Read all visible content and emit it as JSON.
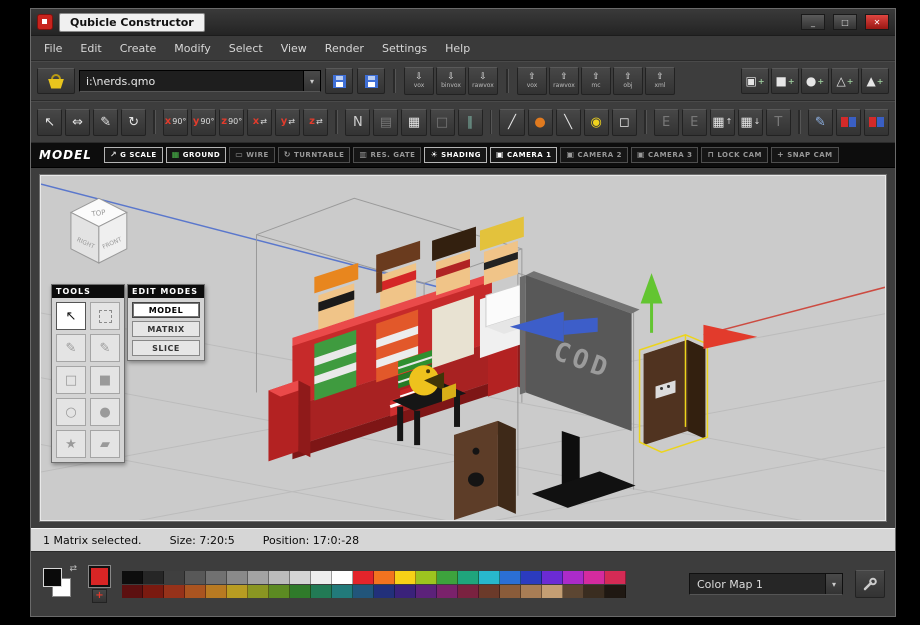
{
  "window": {
    "title": "Qubicle Constructor",
    "controls": {
      "minimize": "_",
      "maximize": "□",
      "close": "✕"
    }
  },
  "menu": {
    "items": [
      "File",
      "Edit",
      "Create",
      "Modify",
      "Select",
      "View",
      "Render",
      "Settings",
      "Help"
    ]
  },
  "file_bar": {
    "path_value": "i:\\nerds.qmo",
    "import_group": [
      "vox",
      "binvox",
      "rawvox"
    ],
    "export_group": [
      "vox",
      "rawvox",
      "mc",
      "obj",
      "xml"
    ],
    "create_shapes": [
      {
        "name": "add-matrix-button",
        "glyph": "▣",
        "color": "#e6e6e6"
      },
      {
        "name": "add-box-button",
        "glyph": "■",
        "color": "#e6e6e6"
      },
      {
        "name": "add-sphere-button",
        "glyph": "●",
        "color": "#e6e6e6"
      },
      {
        "name": "add-triangle-button",
        "glyph": "△",
        "color": "#e6e6e6"
      },
      {
        "name": "add-cone-button",
        "glyph": "▲",
        "color": "#e6e6e6"
      }
    ]
  },
  "tool_row": [
    {
      "name": "transform-tool",
      "glyph": "↖",
      "color": "#e6e6e6"
    },
    {
      "name": "resize-tool",
      "glyph": "⇔",
      "color": "#e6e6e6"
    },
    {
      "name": "draw-tool",
      "glyph": "✎",
      "color": "#e6e6e6"
    },
    {
      "name": "rotate-tool",
      "glyph": "↻",
      "color": "#e6e6e6"
    },
    {
      "type": "sep"
    },
    {
      "name": "rotate-x-90-button",
      "axis": "x",
      "label": "90°"
    },
    {
      "name": "rotate-y-90-button",
      "axis": "y",
      "label": "90°"
    },
    {
      "name": "rotate-z-90-button",
      "axis": "z",
      "label": "90°"
    },
    {
      "name": "mirror-x-button",
      "axis": "x",
      "label": "⇄"
    },
    {
      "name": "mirror-y-button",
      "axis": "y",
      "label": "⇄"
    },
    {
      "name": "mirror-z-button",
      "axis": "z",
      "label": "⇄"
    },
    {
      "type": "sep"
    },
    {
      "name": "normals-tool",
      "glyph": "N",
      "color": "#cfcfcf"
    },
    {
      "name": "copy-button",
      "glyph": "▤",
      "color": "#787878"
    },
    {
      "name": "duplicate-button",
      "glyph": "▦",
      "color": "#e6e6e6"
    },
    {
      "name": "paste-button",
      "glyph": "□",
      "color": "#787878"
    },
    {
      "name": "pause-button",
      "glyph": "∥",
      "color": "#7fb8a8"
    },
    {
      "type": "sep"
    },
    {
      "name": "line-tool",
      "glyph": "╱",
      "color": "#e6e6e6"
    },
    {
      "name": "pumpkin-button",
      "glyph": "●",
      "color": "#e07a1f"
    },
    {
      "name": "eyedropper-tool",
      "glyph": "╲",
      "color": "#e6e6e6"
    },
    {
      "name": "lamp-button",
      "glyph": "◉",
      "color": "#efd21e"
    },
    {
      "name": "cube-button",
      "glyph": "◻",
      "color": "#e6e6e6"
    },
    {
      "type": "sep"
    },
    {
      "name": "extrude-button",
      "glyph": "E",
      "color": "#787878"
    },
    {
      "name": "emboss-button",
      "glyph": "E",
      "color": "#787878"
    },
    {
      "name": "grid-raise-button",
      "glyph": "▦",
      "suffix": "↑",
      "color": "#e6e6e6"
    },
    {
      "name": "grid-lower-button",
      "glyph": "▦",
      "suffix": "↓",
      "color": "#e6e6e6"
    },
    {
      "name": "text-tool",
      "glyph": "T",
      "color": "#787878"
    },
    {
      "type": "sep"
    },
    {
      "name": "gradient-pen-button",
      "glyph": "✎",
      "color": "#8fb3e6"
    },
    {
      "name": "swap-color-button",
      "type": "dual"
    },
    {
      "name": "replace-color-button",
      "type": "dual"
    }
  ],
  "mode_bar": {
    "title": "MODEL",
    "toggles": [
      {
        "name": "gscale-toggle",
        "icon_name": "scale-icon",
        "icon": "↗",
        "icon_color": "#dddddd",
        "label": "G SCALE",
        "active": true
      },
      {
        "name": "ground-toggle",
        "icon_name": "ground-icon",
        "icon": "▦",
        "icon_color": "#49b549",
        "label": "GROUND",
        "active": true
      },
      {
        "name": "wire-toggle",
        "icon_name": "wire-icon",
        "icon": "▭",
        "icon_color": "#9a9a9a",
        "label": "WIRE",
        "active": false
      },
      {
        "name": "turntable-toggle",
        "icon_name": "turntable-icon",
        "icon": "↻",
        "icon_color": "#9a9a9a",
        "label": "TURNTABLE",
        "active": false
      },
      {
        "name": "resgate-toggle",
        "icon_name": "gate-icon",
        "icon": "▥",
        "icon_color": "#9a9a9a",
        "label": "RES. GATE",
        "active": false
      },
      {
        "name": "shading-toggle",
        "icon_name": "sun-icon",
        "icon": "☀",
        "icon_color": "#ffffff",
        "label": "SHADING",
        "active": true
      },
      {
        "name": "camera-1-button",
        "icon_name": "camera-icon",
        "icon": "▣",
        "icon_color": "#ffffff",
        "label": "CAMERA 1",
        "active": true
      },
      {
        "name": "camera-2-button",
        "icon_name": "camera-icon",
        "icon": "▣",
        "icon_color": "#9a9a9a",
        "label": "CAMERA 2",
        "active": false
      },
      {
        "name": "camera-3-button",
        "icon_name": "camera-icon",
        "icon": "▣",
        "icon_color": "#9a9a9a",
        "label": "CAMERA 3",
        "active": false
      },
      {
        "name": "lock-cam-toggle",
        "icon_name": "lock-icon",
        "icon": "⊓",
        "icon_color": "#9a9a9a",
        "label": "LOCK CAM",
        "active": false
      },
      {
        "name": "snap-cam-toggle",
        "icon_name": "snap-icon",
        "icon": "+",
        "icon_color": "#9a9a9a",
        "label": "SNAP CAM",
        "active": false
      }
    ]
  },
  "viewport": {
    "orientation_cube": {
      "top": "TOP",
      "left": "RIGHT",
      "right": "FRONT"
    },
    "monitor_text": "COD"
  },
  "tools_palette": {
    "title": "TOOLS",
    "buttons": [
      {
        "name": "select-tool",
        "glyph": "↖",
        "active": true
      },
      {
        "name": "marquee-tool",
        "box": true
      },
      {
        "name": "pencil-tool",
        "glyph": "✎"
      },
      {
        "name": "pen-tool",
        "glyph": "✎"
      },
      {
        "name": "rect-outline-tool",
        "glyph": "□"
      },
      {
        "name": "rect-fill-tool",
        "glyph": "■"
      },
      {
        "name": "bucket-outline-tool",
        "glyph": "○"
      },
      {
        "name": "bucket-fill-tool",
        "glyph": "●"
      },
      {
        "name": "wand-tool",
        "glyph": "★"
      },
      {
        "name": "eraser-tool",
        "glyph": "▰"
      }
    ]
  },
  "edit_modes": {
    "title": "EDIT MODES",
    "buttons": [
      {
        "name": "edit-mode-model",
        "label": "MODEL",
        "active": true
      },
      {
        "name": "edit-mode-matrix",
        "label": "MATRIX",
        "active": false
      },
      {
        "name": "edit-mode-slice",
        "label": "SLICE",
        "active": false
      }
    ]
  },
  "status_bar": {
    "selection": "1 Matrix selected.",
    "size": "Size: 7:20:5",
    "position": "Position: 17:0:-28"
  },
  "color_bar": {
    "colormap_label": "Color Map 1",
    "active_color": "#d92525",
    "palette_rows": [
      [
        "#0d0d0d",
        "#262626",
        "#3f3f3f",
        "#585858",
        "#717171",
        "#8a8a8a",
        "#a3a3a3",
        "#bcbcbc",
        "#d5d5d5",
        "#eeeeee",
        "#ffffff",
        "#e3242b",
        "#f2731f",
        "#f7d117",
        "#9dc41f",
        "#3da33d",
        "#1fa57c",
        "#28b8cc",
        "#2b6fd4",
        "#2b3bbf",
        "#6b2bd4",
        "#ab2bc9",
        "#d42b9e",
        "#d42b55"
      ],
      [
        "#5c1010",
        "#7a1a10",
        "#96321a",
        "#aa5420",
        "#b87a22",
        "#b89c22",
        "#8a9622",
        "#5c8a22",
        "#2f7a2a",
        "#227a55",
        "#227a7a",
        "#22557a",
        "#22307a",
        "#3a227a",
        "#5c227a",
        "#7a226b",
        "#7a2240",
        "#6b3a2a",
        "#8a5c3a",
        "#a87d55",
        "#c49e73",
        "#5c4632",
        "#3a2d20",
        "#1f1812"
      ]
    ]
  }
}
